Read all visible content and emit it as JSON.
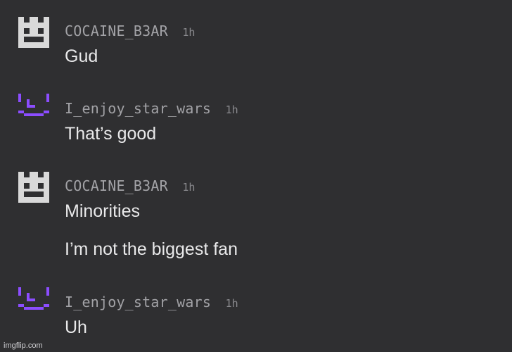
{
  "colors": {
    "background": "#2f2f31",
    "username": "#a2a2a6",
    "timestamp": "#8a8a8e",
    "message": "#e9e9ea",
    "avatar_gray": "#d9d9d9",
    "avatar_purple": "#8c4dff"
  },
  "comments": [
    {
      "username": "COCAINE_B3AR",
      "time": "1h",
      "avatar_icon": "pixel-face-gray-icon",
      "messages": [
        "Gud"
      ]
    },
    {
      "username": "I_enjoy_star_wars",
      "time": "1h",
      "avatar_icon": "pixel-smile-purple-icon",
      "messages": [
        "That’s good"
      ]
    },
    {
      "username": "COCAINE_B3AR",
      "time": "1h",
      "avatar_icon": "pixel-face-gray-icon",
      "messages": [
        "Minorities",
        "I’m not the biggest fan"
      ]
    },
    {
      "username": "I_enjoy_star_wars",
      "time": "1h",
      "avatar_icon": "pixel-smile-purple-icon",
      "messages": [
        "Uh"
      ]
    }
  ],
  "watermark": "imgflip.com"
}
